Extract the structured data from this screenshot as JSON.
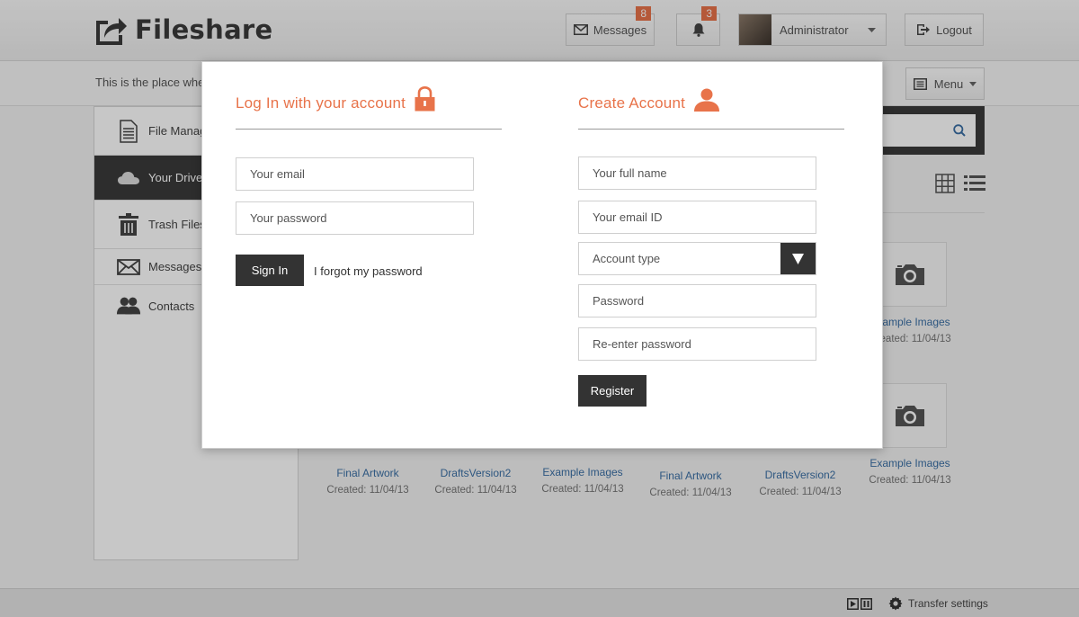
{
  "app": {
    "title": "Fileshare",
    "tagline": "This is the place whe"
  },
  "header": {
    "messages_label": "Messages",
    "messages_count": "8",
    "notifications_count": "3",
    "user_name": "Administrator",
    "logout_label": "Logout"
  },
  "subbar": {
    "menu_label": "Menu"
  },
  "sidebar": {
    "items": [
      {
        "label": "File Manag",
        "icon": "document-icon"
      },
      {
        "label": "Your Drive",
        "icon": "cloud-icon"
      },
      {
        "label": "Trash Files",
        "icon": "trash-icon"
      },
      {
        "label": "Messages",
        "icon": "envelope-icon"
      },
      {
        "label": "Contacts",
        "icon": "contacts-icon"
      }
    ]
  },
  "tiles": [
    {
      "name": "Example Images",
      "date": "Created: 11/04/13"
    },
    {
      "name": "Final Artwork",
      "date": "Created: 11/04/13"
    },
    {
      "name": "DraftsVersion2",
      "date": "Created: 11/04/13"
    },
    {
      "name": "Example Images",
      "date": "Created: 11/04/13"
    },
    {
      "name": "Final Artwork",
      "date": "Created: 11/04/13"
    },
    {
      "name": "DraftsVersion2",
      "date": "Created: 11/04/13"
    },
    {
      "name": "Example Images",
      "date": "Created: 11/04/13"
    }
  ],
  "footer": {
    "transfer_label": "Transfer settings"
  },
  "login": {
    "title": "Log In with your account",
    "email_placeholder": "Your email",
    "password_placeholder": "Your password",
    "signin_label": "Sign In",
    "forgot_label": "I forgot my password"
  },
  "register": {
    "title": "Create Account",
    "fullname_placeholder": "Your full name",
    "email_placeholder": "Your email ID",
    "account_type_value": "Account type",
    "password_placeholder": "Password",
    "reenter_placeholder": "Re-enter password",
    "register_label": "Register"
  },
  "colors": {
    "accent": "#e8734a",
    "dark": "#333333",
    "link": "#3a6fa5"
  }
}
